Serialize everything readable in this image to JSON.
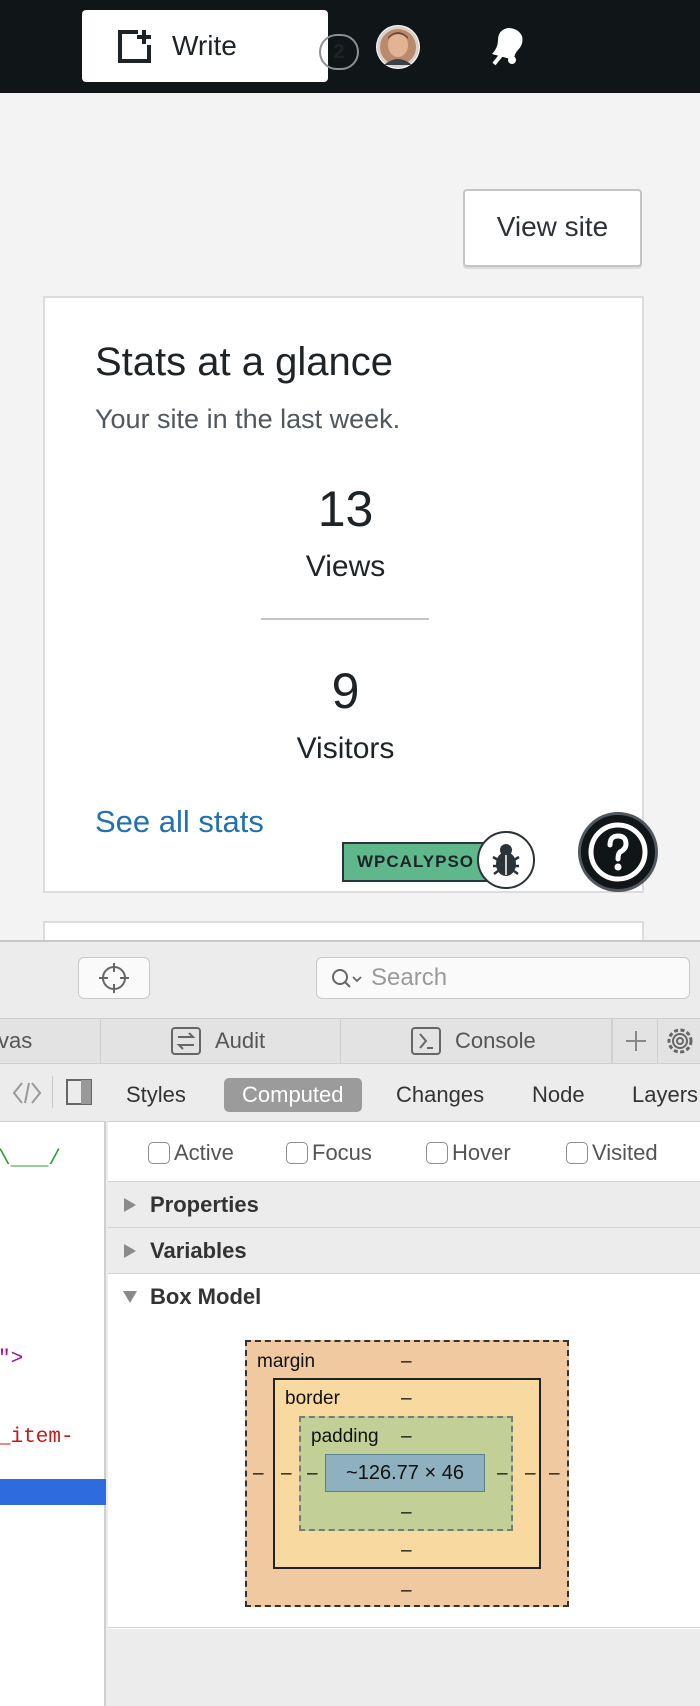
{
  "masterbar": {
    "write_label": "Write",
    "write_count": "2"
  },
  "main": {
    "view_site_label": "View site",
    "card": {
      "title": "Stats at a glance",
      "subtitle": "Your site in the last week.",
      "views_value": "13",
      "views_label": "Views",
      "visitors_value": "9",
      "visitors_label": "Visitors",
      "see_all_label": "See all stats"
    },
    "env_badge": "WPCALYPSO"
  },
  "devtools": {
    "search_placeholder": "Search",
    "tabs": [
      {
        "label": "vas"
      },
      {
        "label": "Audit"
      },
      {
        "label": "Console"
      }
    ],
    "left_code": {
      "line1": "\\___/",
      "line2": "\">",
      "line3": "_item-"
    },
    "sub_tabs": [
      "Styles",
      "Computed",
      "Changes",
      "Node",
      "Layers"
    ],
    "active_sub_tab": "Computed",
    "pseudo_classes": [
      "Active",
      "Focus",
      "Hover",
      "Visited"
    ],
    "sections": [
      "Properties",
      "Variables",
      "Box Model"
    ],
    "box_model": {
      "margin_label": "margin",
      "border_label": "border",
      "padding_label": "padding",
      "content": "~126.77 × 46",
      "dash": "–"
    }
  },
  "colors": {
    "masterbar": "#101517",
    "link": "#2271b1",
    "badge": "#5fb88c",
    "selected_row": "#2e6bde"
  }
}
